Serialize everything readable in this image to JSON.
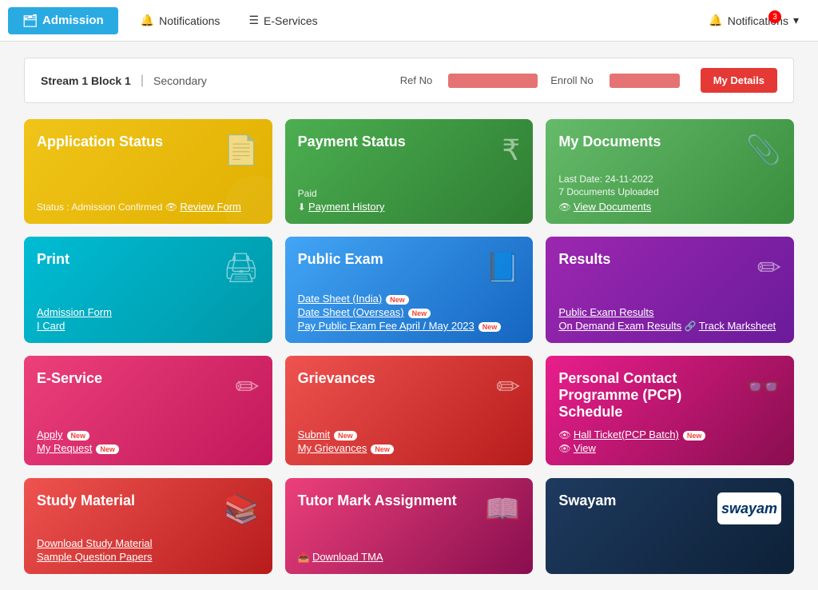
{
  "navbar": {
    "admission_label": "Admission",
    "notifications_label": "Notifications",
    "eservices_label": "E-Services",
    "right_notifications_label": "Notifications",
    "notification_count": "3"
  },
  "breadcrumb": {
    "stream": "Stream 1 Block 1",
    "secondary": "Secondary",
    "ref_label": "Ref No",
    "enroll_label": "Enroll No",
    "my_details_label": "My Details"
  },
  "cards": {
    "application_status": {
      "title": "Application Status",
      "status_text": "Status : Admission Confirmed",
      "review_form": "Review Form"
    },
    "payment_status": {
      "title": "Payment Status",
      "paid_text": "Paid",
      "payment_history": "Payment History"
    },
    "my_documents": {
      "title": "My Documents",
      "last_date": "Last Date: 24-11-2022",
      "uploaded": "7 Documents Uploaded",
      "view_documents": "View Documents"
    },
    "print": {
      "title": "Print",
      "admission_form": "Admission Form",
      "i_card": "I Card"
    },
    "public_exam": {
      "title": "Public Exam",
      "date_sheet_india": "Date Sheet (India)",
      "date_sheet_overseas": "Date Sheet (Overseas)",
      "pay_fee": "Pay Public Exam Fee April / May 2023"
    },
    "results": {
      "title": "Results",
      "public_exam": "Public Exam Results",
      "on_demand": "On Demand Exam Results",
      "track": "Track Marksheet"
    },
    "eservice": {
      "title": "E-Service",
      "apply": "Apply",
      "my_request": "My Request"
    },
    "grievances": {
      "title": "Grievances",
      "submit": "Submit",
      "my_grievances": "My Grievances"
    },
    "pcp": {
      "title": "Personal Contact Programme (PCP) Schedule",
      "hall_ticket": "Hall Ticket(PCP Batch)",
      "view": "View"
    },
    "study_material": {
      "title": "Study Material",
      "download": "Download Study Material",
      "sample": "Sample Question Papers"
    },
    "tutor_mark": {
      "title": "Tutor Mark Assignment",
      "download_tma": "Download TMA"
    },
    "swayam": {
      "title": "Swayam",
      "logo_text": "swayam"
    }
  }
}
